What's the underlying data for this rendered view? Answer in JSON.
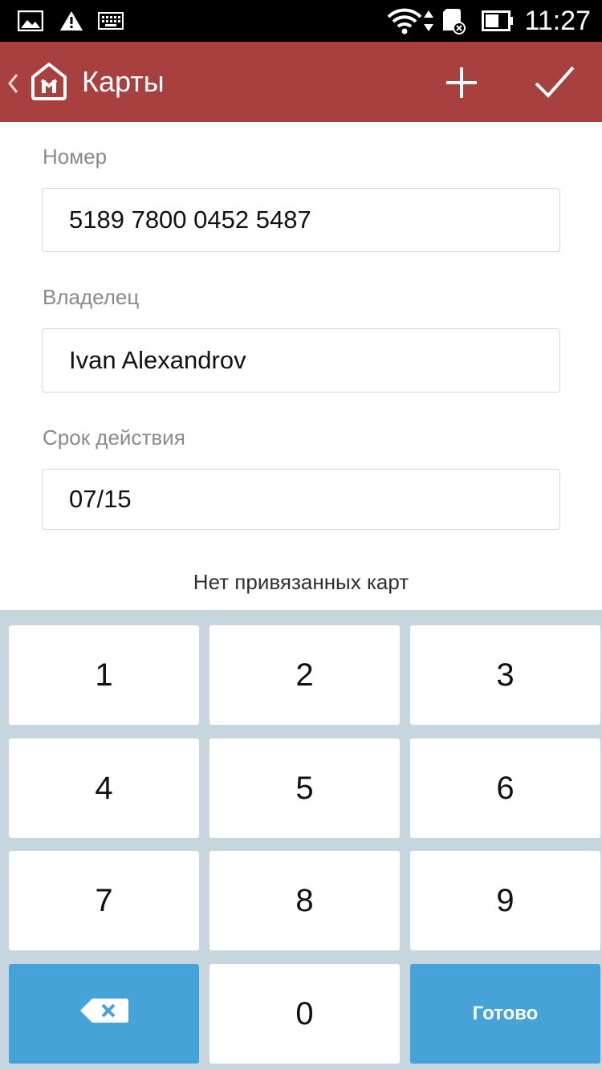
{
  "status_bar": {
    "time": "11:27",
    "icons": [
      "gallery-icon",
      "warning-icon",
      "keyboard-icon",
      "wifi-icon",
      "data-arrows-icon",
      "sdcard-icon",
      "battery-icon"
    ]
  },
  "app_bar": {
    "title": "Карты",
    "color": "#a84040",
    "icons": [
      "back-chevron-icon",
      "app-logo-icon",
      "add-icon",
      "checkmark-icon"
    ]
  },
  "form": {
    "number_label": "Номер",
    "number_value": "5189 7800 0452 5487",
    "owner_label": "Владелец",
    "owner_value": "Ivan Alexandrov",
    "expiry_label": "Срок действия",
    "expiry_value": "07/15"
  },
  "empty_message": "Нет привязанных карт",
  "keypad": {
    "keys": [
      "1",
      "2",
      "3",
      "4",
      "5",
      "6",
      "7",
      "8",
      "9",
      "0"
    ],
    "done_label": "Готово",
    "accent_color": "#45a3d8",
    "background_color": "#c6d5de"
  }
}
